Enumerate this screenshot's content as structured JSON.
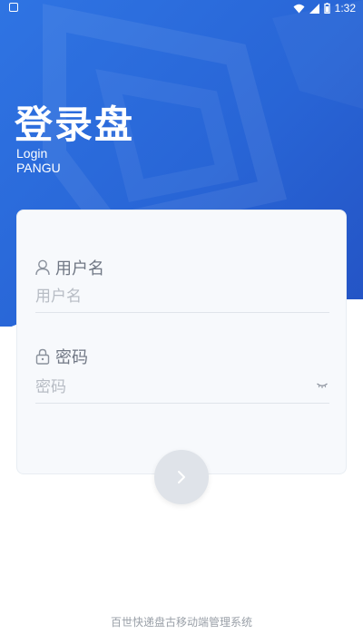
{
  "status_bar": {
    "time": "1:32"
  },
  "header": {
    "title": "登录盘",
    "subtitle_line1": "Login",
    "subtitle_line2": "PANGU"
  },
  "form": {
    "username": {
      "label": "用户名",
      "placeholder": "用户名",
      "value": ""
    },
    "password": {
      "label": "密码",
      "placeholder": "密码",
      "value": ""
    }
  },
  "footer": {
    "text": "百世快递盘古移动端管理系统"
  },
  "colors": {
    "primary_blue": "#2a69d9",
    "submit_button": "#dfe3e9"
  },
  "icons": {
    "username": "user-icon",
    "password": "lock-icon",
    "toggle": "eye-closed-icon",
    "submit": "chevron-right-icon"
  }
}
